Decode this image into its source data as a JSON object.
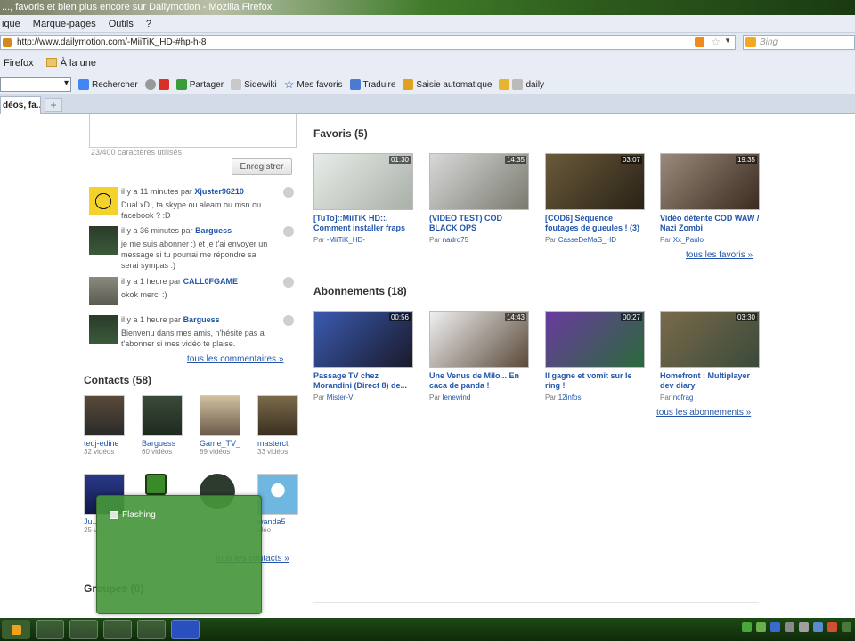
{
  "window": {
    "title": "..., favoris et bien plus encore sur Dailymotion - Mozilla Firefox"
  },
  "menubar": {
    "items": [
      "ique",
      "Marque-pages",
      "Outils",
      "?"
    ]
  },
  "navbar": {
    "url": "http://www.dailymotion.com/-MiiTiK_HD-#hp-h-8",
    "search_placeholder": "Bing"
  },
  "bookmarks": {
    "items": [
      "Firefox",
      "À la une"
    ]
  },
  "toolbar": {
    "items": [
      "Rechercher",
      "Partager",
      "Sidewiki",
      "Mes favoris",
      "Traduire",
      "Saisie automatique",
      "daily"
    ]
  },
  "tabs": {
    "active_label": "déos, fa..."
  },
  "comments_section": {
    "char_count": "23/400 caractères utilisés",
    "save_button": "Enregistrer",
    "comments": [
      {
        "time": "il y a 11 minutes par",
        "author": "Xjuster96210",
        "text": "Dual xD , ta skype ou aleam ou msn ou facebook ? :D"
      },
      {
        "time": "il y a 36 minutes par",
        "author": "Barguess",
        "text": "je me suis abonner :) et je t'ai envoyer un message si tu pourrai me répondre sa serai sympas :)"
      },
      {
        "time": "il y a 1 heure par",
        "author": "CALL0FGAME",
        "text": "okok merci :)"
      },
      {
        "time": "il y a 1 heure par",
        "author": "Barguess",
        "text": "Bienvenu dans mes amis, n'hésite pas a t'abonner si mes vidéo te plaise."
      }
    ],
    "all_link": "tous les commentaires »"
  },
  "contacts": {
    "title": "Contacts (58)",
    "items": [
      {
        "name": "tedj-edine",
        "sub": "32 vidéos"
      },
      {
        "name": "Barguess",
        "sub": "60 vidéos"
      },
      {
        "name": "Game_TV_",
        "sub": "89 vidéos"
      },
      {
        "name": "mastercti",
        "sub": "33 vidéos"
      },
      {
        "name": "Ju...",
        "sub": "25 v..."
      },
      {
        "name": "",
        "sub": ""
      },
      {
        "name": "",
        "sub": ""
      },
      {
        "name": "wanda5",
        "sub": "idéo"
      }
    ],
    "all_link": "tous les contacts »"
  },
  "groupes": {
    "title": "Groupes (0)"
  },
  "favoris": {
    "title": "Favoris (5)",
    "videos": [
      {
        "title": "[TuTo]::MiiTiK HD::. Comment installer fraps",
        "by": "Par",
        "user": "-MiiTiK_HD-",
        "duration": "01:30"
      },
      {
        "title": "(VIDEO TEST) COD BLACK OPS",
        "by": "Par",
        "user": "nadro75",
        "duration": "14:35"
      },
      {
        "title": "[COD6] Séquence foutages de gueules ! (3)",
        "by": "Par",
        "user": "CasseDeMaS_HD",
        "duration": "03:07"
      },
      {
        "title": "Vidéo détente COD WAW / Nazi Zombi",
        "by": "Par",
        "user": "Xx_Paulo",
        "duration": "19:35"
      }
    ],
    "all_link": "tous les favoris »"
  },
  "abonnements": {
    "title": "Abonnements (18)",
    "videos": [
      {
        "title": "Passage TV chez Morandini (Direct 8) de...",
        "by": "Par",
        "user": "Mister-V",
        "duration": "00:56"
      },
      {
        "title": "Une Venus de Milo... En caca de panda !",
        "by": "Par",
        "user": "lenewind",
        "duration": "14:43"
      },
      {
        "title": "Il gagne et vomit sur le ring !",
        "by": "Par",
        "user": "12infos",
        "duration": "00:27"
      },
      {
        "title": "Homefront : Multiplayer dev diary",
        "by": "Par",
        "user": "nofrag",
        "duration": "03:30"
      }
    ],
    "all_link": "tous les abonnements »"
  },
  "flash_popup": {
    "label": "Flashing"
  },
  "colors": {
    "link": "#2255aa",
    "taskbar": "#1c4a14",
    "popup": "#46963c"
  }
}
